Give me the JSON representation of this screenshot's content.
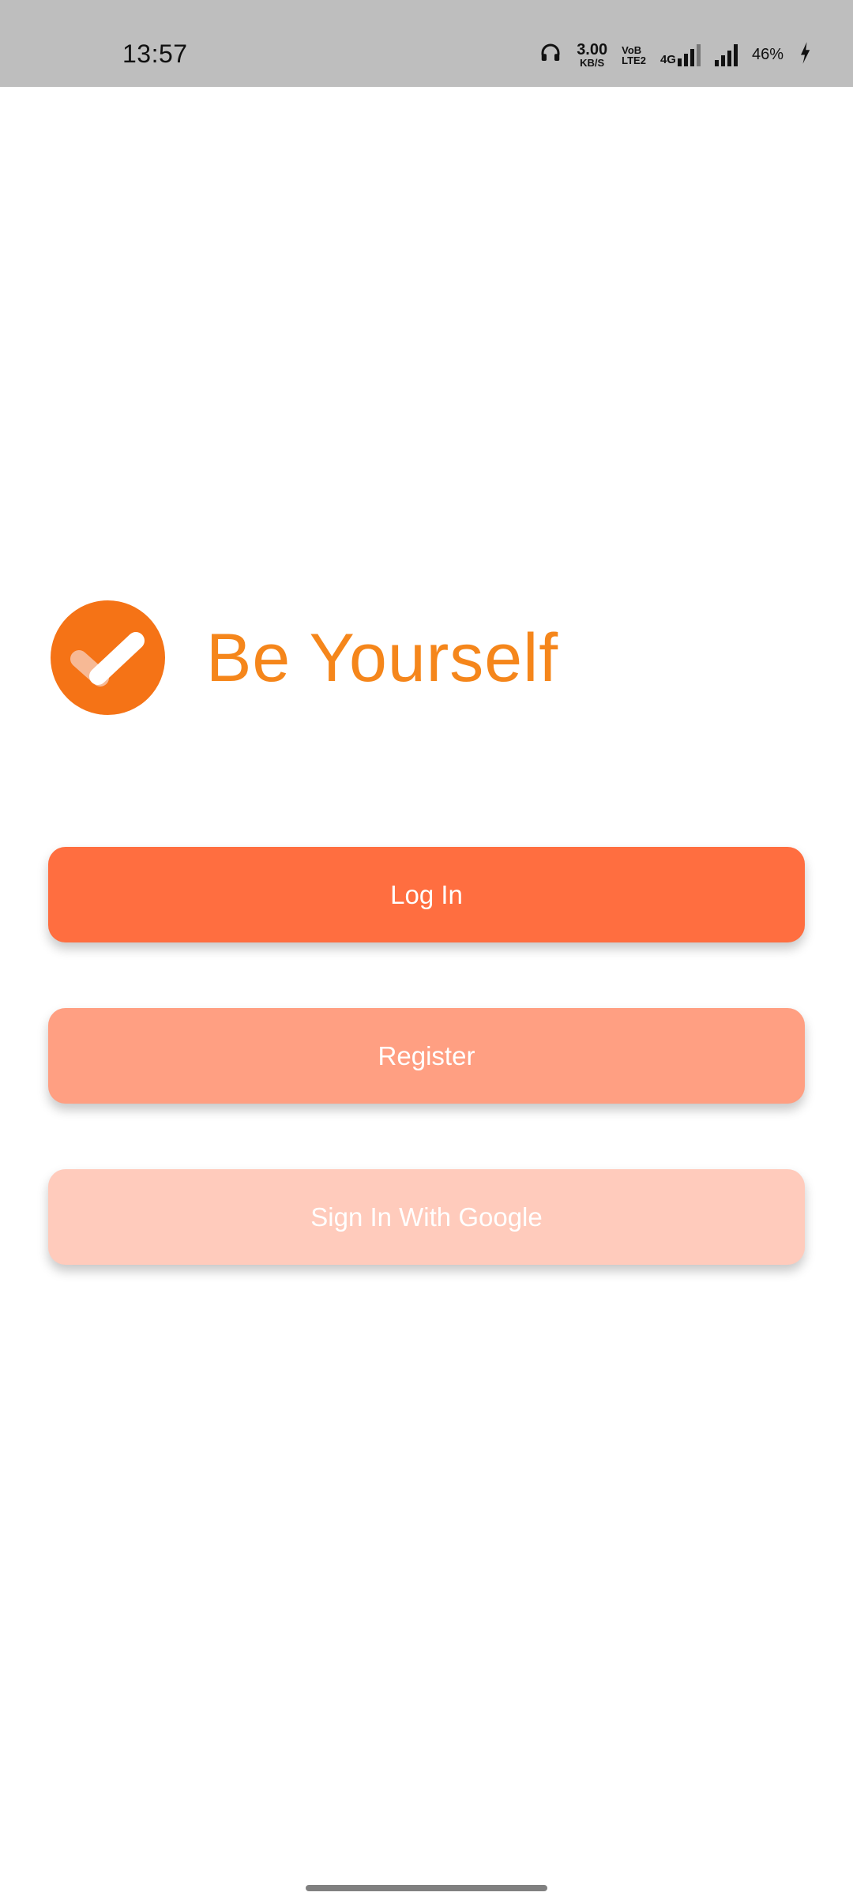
{
  "status_bar": {
    "time": "13:57",
    "speed_value": "3.00",
    "speed_unit": "KB/S",
    "volte_line1": "VoB",
    "volte_line2": "LTE2",
    "network": "4G",
    "battery": "46%",
    "signal_level": 4
  },
  "brand": {
    "title": "Be Yourself",
    "logo_color": "#f57316",
    "title_color": "#f5861b"
  },
  "buttons": {
    "login": "Log In",
    "register": "Register",
    "google": "Sign In With Google"
  },
  "colors": {
    "login": "#ff6e40",
    "register": "#ff9f82",
    "google": "#ffcbbc"
  }
}
